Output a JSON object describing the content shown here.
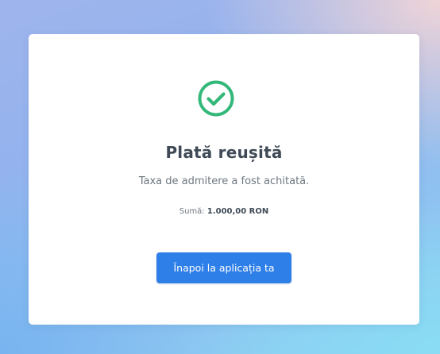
{
  "icon": {
    "name": "check-circle-icon",
    "color": "#34b87a"
  },
  "title": "Plată reușită",
  "subtitle": "Taxa de admitere a fost achitată.",
  "amount": {
    "label": "Sumă:",
    "value": "1.000,00 RON"
  },
  "back_button": {
    "label": "Înapoi la aplicația ta",
    "color": "#2f7fe8"
  }
}
